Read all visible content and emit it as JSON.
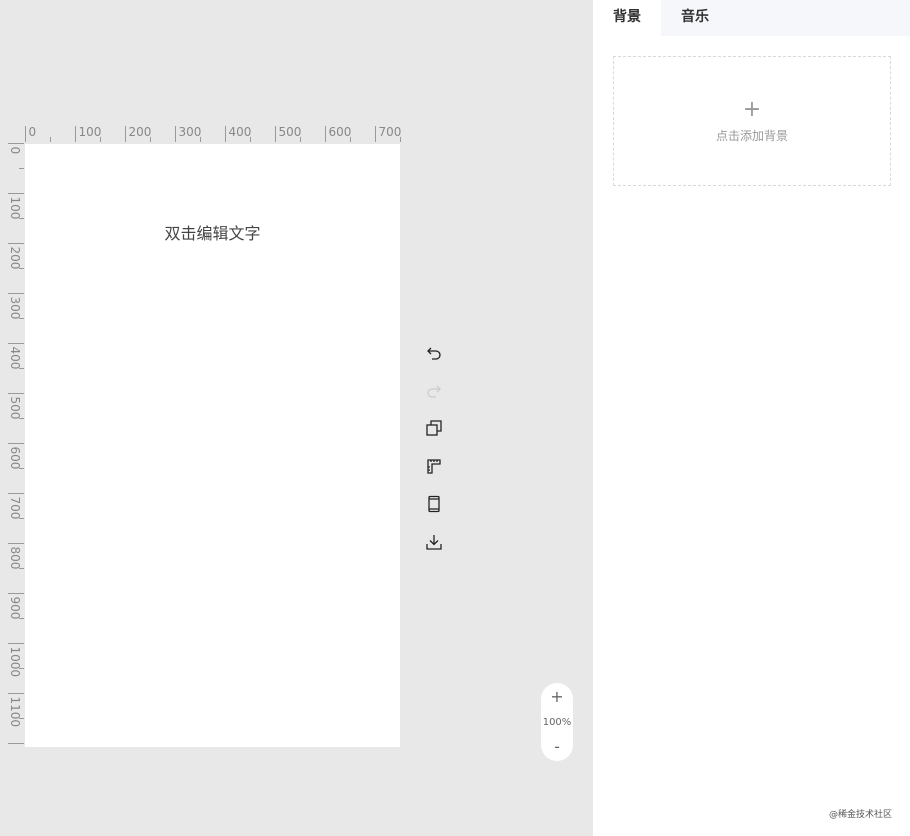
{
  "canvas": {
    "text": "双击编辑文字",
    "horizontal_ruler_labels": [
      "0",
      "100",
      "200",
      "300",
      "400",
      "500",
      "600",
      "700"
    ],
    "vertical_ruler_labels": [
      "0",
      "100",
      "200",
      "300",
      "400",
      "500",
      "600",
      "700",
      "800",
      "900",
      "1000",
      "1100"
    ]
  },
  "toolbar": {
    "items": [
      {
        "icon": "undo-icon",
        "enabled": true
      },
      {
        "icon": "redo-icon",
        "enabled": false
      },
      {
        "icon": "copy-icon",
        "enabled": true
      },
      {
        "icon": "ruler-icon",
        "enabled": true
      },
      {
        "icon": "mobile-preview-icon",
        "enabled": true
      },
      {
        "icon": "download-icon",
        "enabled": true
      }
    ]
  },
  "zoom": {
    "plus": "+",
    "level": "100%",
    "minus": "-"
  },
  "panel": {
    "tabs": [
      {
        "label": "背景",
        "active": true
      },
      {
        "label": "音乐",
        "active": false
      }
    ],
    "add_background": {
      "plus": "+",
      "label": "点击添加背景"
    }
  },
  "watermark": "@稀金技术社区",
  "colors": {
    "workspace_bg": "#e8e8e8",
    "tab_bar_bg": "#f5f7fb",
    "disabled_icon": "#cccccc",
    "icon": "#222222"
  }
}
